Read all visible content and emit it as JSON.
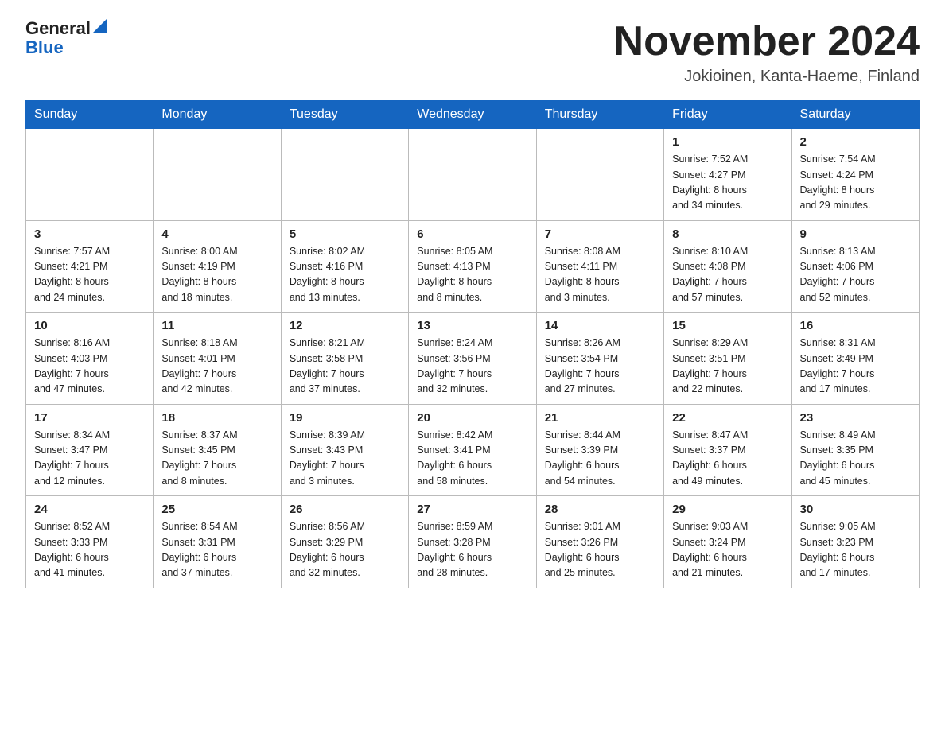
{
  "header": {
    "logo_line1": "General",
    "logo_line2": "Blue",
    "month_title": "November 2024",
    "location": "Jokioinen, Kanta-Haeme, Finland"
  },
  "weekdays": [
    "Sunday",
    "Monday",
    "Tuesday",
    "Wednesday",
    "Thursday",
    "Friday",
    "Saturday"
  ],
  "weeks": [
    [
      {
        "day": "",
        "info": ""
      },
      {
        "day": "",
        "info": ""
      },
      {
        "day": "",
        "info": ""
      },
      {
        "day": "",
        "info": ""
      },
      {
        "day": "",
        "info": ""
      },
      {
        "day": "1",
        "info": "Sunrise: 7:52 AM\nSunset: 4:27 PM\nDaylight: 8 hours\nand 34 minutes."
      },
      {
        "day": "2",
        "info": "Sunrise: 7:54 AM\nSunset: 4:24 PM\nDaylight: 8 hours\nand 29 minutes."
      }
    ],
    [
      {
        "day": "3",
        "info": "Sunrise: 7:57 AM\nSunset: 4:21 PM\nDaylight: 8 hours\nand 24 minutes."
      },
      {
        "day": "4",
        "info": "Sunrise: 8:00 AM\nSunset: 4:19 PM\nDaylight: 8 hours\nand 18 minutes."
      },
      {
        "day": "5",
        "info": "Sunrise: 8:02 AM\nSunset: 4:16 PM\nDaylight: 8 hours\nand 13 minutes."
      },
      {
        "day": "6",
        "info": "Sunrise: 8:05 AM\nSunset: 4:13 PM\nDaylight: 8 hours\nand 8 minutes."
      },
      {
        "day": "7",
        "info": "Sunrise: 8:08 AM\nSunset: 4:11 PM\nDaylight: 8 hours\nand 3 minutes."
      },
      {
        "day": "8",
        "info": "Sunrise: 8:10 AM\nSunset: 4:08 PM\nDaylight: 7 hours\nand 57 minutes."
      },
      {
        "day": "9",
        "info": "Sunrise: 8:13 AM\nSunset: 4:06 PM\nDaylight: 7 hours\nand 52 minutes."
      }
    ],
    [
      {
        "day": "10",
        "info": "Sunrise: 8:16 AM\nSunset: 4:03 PM\nDaylight: 7 hours\nand 47 minutes."
      },
      {
        "day": "11",
        "info": "Sunrise: 8:18 AM\nSunset: 4:01 PM\nDaylight: 7 hours\nand 42 minutes."
      },
      {
        "day": "12",
        "info": "Sunrise: 8:21 AM\nSunset: 3:58 PM\nDaylight: 7 hours\nand 37 minutes."
      },
      {
        "day": "13",
        "info": "Sunrise: 8:24 AM\nSunset: 3:56 PM\nDaylight: 7 hours\nand 32 minutes."
      },
      {
        "day": "14",
        "info": "Sunrise: 8:26 AM\nSunset: 3:54 PM\nDaylight: 7 hours\nand 27 minutes."
      },
      {
        "day": "15",
        "info": "Sunrise: 8:29 AM\nSunset: 3:51 PM\nDaylight: 7 hours\nand 22 minutes."
      },
      {
        "day": "16",
        "info": "Sunrise: 8:31 AM\nSunset: 3:49 PM\nDaylight: 7 hours\nand 17 minutes."
      }
    ],
    [
      {
        "day": "17",
        "info": "Sunrise: 8:34 AM\nSunset: 3:47 PM\nDaylight: 7 hours\nand 12 minutes."
      },
      {
        "day": "18",
        "info": "Sunrise: 8:37 AM\nSunset: 3:45 PM\nDaylight: 7 hours\nand 8 minutes."
      },
      {
        "day": "19",
        "info": "Sunrise: 8:39 AM\nSunset: 3:43 PM\nDaylight: 7 hours\nand 3 minutes."
      },
      {
        "day": "20",
        "info": "Sunrise: 8:42 AM\nSunset: 3:41 PM\nDaylight: 6 hours\nand 58 minutes."
      },
      {
        "day": "21",
        "info": "Sunrise: 8:44 AM\nSunset: 3:39 PM\nDaylight: 6 hours\nand 54 minutes."
      },
      {
        "day": "22",
        "info": "Sunrise: 8:47 AM\nSunset: 3:37 PM\nDaylight: 6 hours\nand 49 minutes."
      },
      {
        "day": "23",
        "info": "Sunrise: 8:49 AM\nSunset: 3:35 PM\nDaylight: 6 hours\nand 45 minutes."
      }
    ],
    [
      {
        "day": "24",
        "info": "Sunrise: 8:52 AM\nSunset: 3:33 PM\nDaylight: 6 hours\nand 41 minutes."
      },
      {
        "day": "25",
        "info": "Sunrise: 8:54 AM\nSunset: 3:31 PM\nDaylight: 6 hours\nand 37 minutes."
      },
      {
        "day": "26",
        "info": "Sunrise: 8:56 AM\nSunset: 3:29 PM\nDaylight: 6 hours\nand 32 minutes."
      },
      {
        "day": "27",
        "info": "Sunrise: 8:59 AM\nSunset: 3:28 PM\nDaylight: 6 hours\nand 28 minutes."
      },
      {
        "day": "28",
        "info": "Sunrise: 9:01 AM\nSunset: 3:26 PM\nDaylight: 6 hours\nand 25 minutes."
      },
      {
        "day": "29",
        "info": "Sunrise: 9:03 AM\nSunset: 3:24 PM\nDaylight: 6 hours\nand 21 minutes."
      },
      {
        "day": "30",
        "info": "Sunrise: 9:05 AM\nSunset: 3:23 PM\nDaylight: 6 hours\nand 17 minutes."
      }
    ]
  ]
}
